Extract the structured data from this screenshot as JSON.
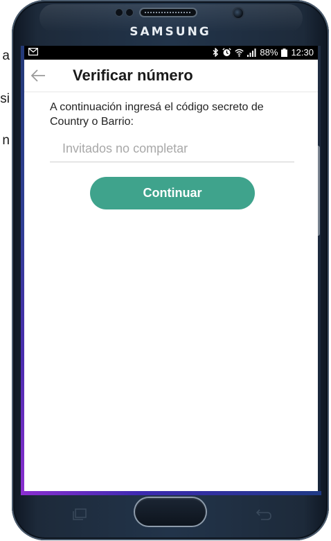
{
  "background_text": {
    "letter_a": "a",
    "letter_si": "si",
    "letter_n": "n"
  },
  "device": {
    "brand": "SAMSUNG"
  },
  "status_bar": {
    "battery_percent": "88%",
    "time": "12:30",
    "icons": [
      "mail-icon",
      "bluetooth-icon",
      "alarm-icon",
      "wifi-icon",
      "signal-icon",
      "battery-icon"
    ]
  },
  "app_bar": {
    "title": "Verificar número",
    "back_icon": "back-arrow-icon"
  },
  "form": {
    "instruction": "A continuación ingresá el código secreto de Country o Barrio:",
    "code_input": {
      "placeholder": "Invitados no completar",
      "value": ""
    },
    "continue_label": "Continuar"
  },
  "colors": {
    "accent": "#3fa38c",
    "status_bar": "#000000"
  }
}
